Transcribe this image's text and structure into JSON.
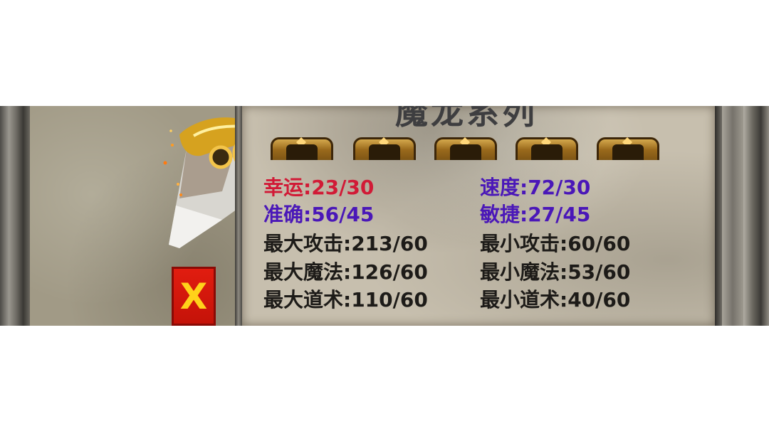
{
  "panel": {
    "title": "魔龙系列",
    "slot_icons": [
      "equip-slot-1-icon",
      "equip-slot-2-icon",
      "equip-slot-3-icon",
      "equip-slot-4-icon",
      "equip-slot-5-icon"
    ]
  },
  "stats": {
    "luck": "幸运:23/30",
    "speed": "速度:72/30",
    "accuracy": "准确:56/45",
    "agility": "敏捷:27/45",
    "max_attack": "最大攻击:213/60",
    "min_attack": "最小攻击:60/60",
    "max_magic": "最大魔法:126/60",
    "min_magic": "最小魔法:53/60",
    "max_taoism": "最大道术:110/60",
    "min_taoism": "最小道术:40/60"
  },
  "close_button": {
    "label": "X"
  },
  "colors": {
    "luck_text": "#d11a36",
    "accent_text": "#4a17b8",
    "default_text": "#1d1b18",
    "close_bg": "#e21d10",
    "close_label": "#ffd21a"
  },
  "icons": {
    "weapon": "broadsword-icon",
    "close": "close-icon"
  }
}
